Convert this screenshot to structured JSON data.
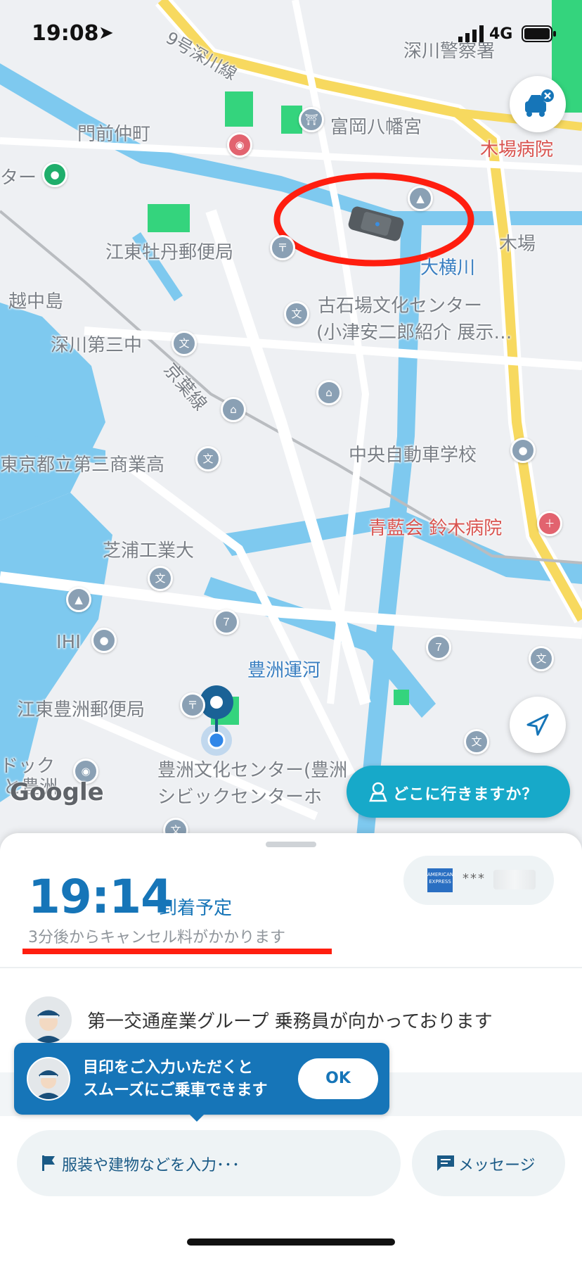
{
  "status_bar": {
    "time": "19:08",
    "network": "4G"
  },
  "map": {
    "google_logo": "Google",
    "labels": {
      "fukagawa_police": "深川警察署",
      "monzen_nakacho": "門前仲町",
      "tomioka_hachimangu": "富岡八幡宮",
      "kiba_hospital": "木場病院",
      "ta": "ター",
      "kiba": "木場",
      "koto_botan_post": "江東牡丹郵便局",
      "okokogawa": "大横川",
      "ecchujima": "越中島",
      "furuishiba_center_1": "古石場文化センター",
      "furuishiba_center_2": "(小津安二郎紹介 展示…",
      "fukagawa_dai3": "深川第三中",
      "keiyo_line": "京葉線",
      "tokyo_dai3_shogyo": "東京都立第三商業高",
      "chuo_jidosha": "中央自動車学校",
      "seiran_suzuki": "青藍会 鈴木病院",
      "shibaura_kodai": "芝浦工業大",
      "ihi": "IHI",
      "toyosu_unga": "豊洲運河",
      "koto_toyosu_post": "江東豊洲郵便局",
      "toyosu_bunka_1": "豊洲文化センター(豊洲",
      "toyosu_bunka_2": "シビックセンターホ",
      "dock": "ドック",
      "toyosu_small": "と豊洲",
      "road_sign": "9号深川線"
    }
  },
  "destination_button": {
    "label": "どこに行きますか？"
  },
  "sheet": {
    "eta_time": "19:14",
    "eta_label": "到着予定",
    "cancel_notice": "3分後からキャンセル料がかかります",
    "card_brand": "AMERICAN EXPRESS",
    "card_masked": "***",
    "driver_message": "第一交通産業グループ 乗務員が向かっております",
    "tip": {
      "line1": "目印をご入力いただくと",
      "line2": "スムーズにご乗車できます",
      "ok": "OK"
    },
    "mark_input_placeholder": "服装や建物などを入力･･･",
    "message_button": "メッセージ"
  },
  "colors": {
    "accent": "#1675b8",
    "teal": "#17a9c9",
    "highlight_red": "#ff1e0f"
  }
}
